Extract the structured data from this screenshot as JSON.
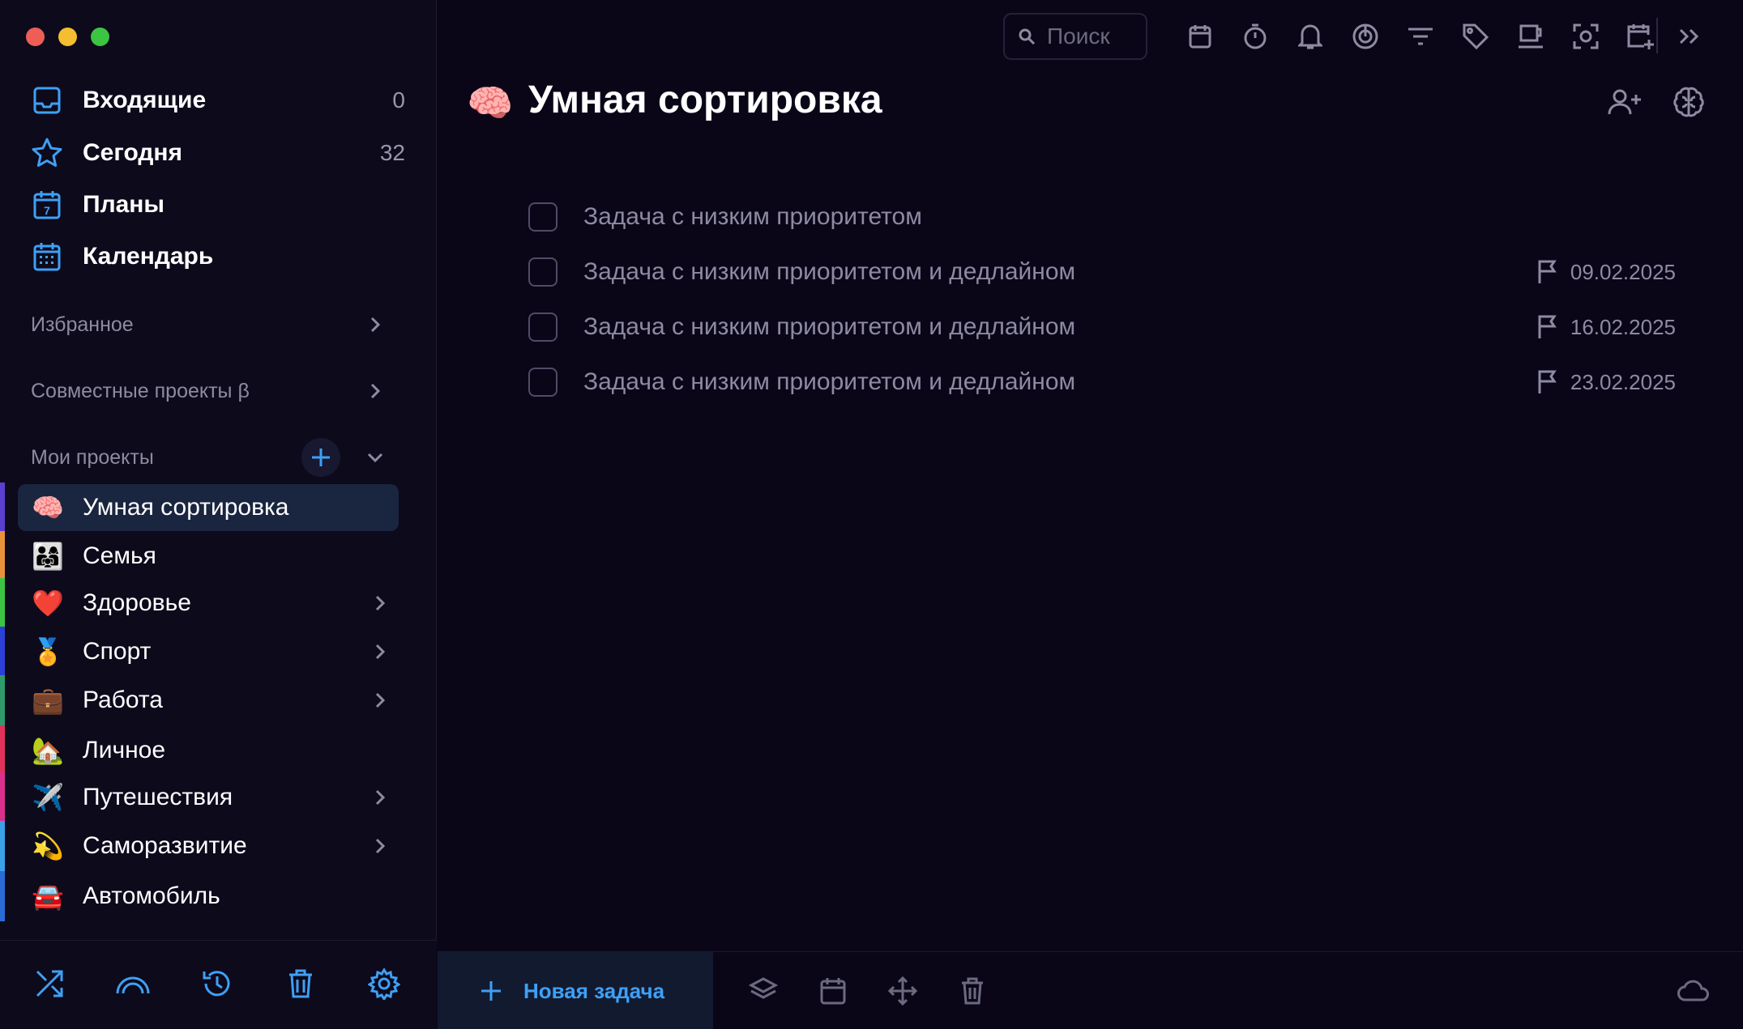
{
  "window": {
    "controls": [
      "close",
      "minimize",
      "zoom"
    ]
  },
  "colors": {
    "accent": "#3ea0f5",
    "background": "#0a0618",
    "sidebar": "#0d0a1c",
    "active_item": "#1a2540",
    "muted_text": "#8d8aa2"
  },
  "sidebar": {
    "nav": [
      {
        "label": "Входящие",
        "count": "0",
        "icon": "inbox-icon"
      },
      {
        "label": "Сегодня",
        "count": "32",
        "icon": "star-icon"
      },
      {
        "label": "Планы",
        "count": "",
        "icon": "calendar-7-icon"
      },
      {
        "label": "Календарь",
        "count": "",
        "icon": "calendar-grid-icon"
      }
    ],
    "sections": {
      "favorites": "Избранное",
      "shared": "Совместные проекты β",
      "my_projects": "Мои проекты"
    },
    "projects": [
      {
        "emoji": "🧠",
        "label": "Умная сортировка",
        "active": true,
        "expandable": false,
        "stripe": "#5b3fd0"
      },
      {
        "emoji": "👨‍👩‍👧",
        "label": "Семья",
        "active": false,
        "expandable": false,
        "stripe": "#e8923a"
      },
      {
        "emoji": "❤️",
        "label": "Здоровье",
        "active": false,
        "expandable": true,
        "stripe": "#3cc443"
      },
      {
        "emoji": "🏅",
        "label": "Спорт",
        "active": false,
        "expandable": true,
        "stripe": "#2c3fd8"
      },
      {
        "emoji": "💼",
        "label": "Работа",
        "active": false,
        "expandable": true,
        "stripe": "#2f9a6a"
      },
      {
        "emoji": "🏡",
        "label": "Личное",
        "active": false,
        "expandable": false,
        "stripe": "#e0325a"
      },
      {
        "emoji": "✈️",
        "label": "Путешествия",
        "active": false,
        "expandable": true,
        "stripe": "#d9308e"
      },
      {
        "emoji": "💫",
        "label": "Саморазвитие",
        "active": false,
        "expandable": true,
        "stripe": "#3aa0e8"
      },
      {
        "emoji": "🚘",
        "label": "Автомобиль",
        "active": false,
        "expandable": false,
        "stripe": "#2b6bd6"
      }
    ],
    "bottom_icons": [
      "shuffle-icon",
      "rainbow-icon",
      "history-icon",
      "trash-icon",
      "settings-icon"
    ]
  },
  "toolbar": {
    "search_placeholder": "Поиск",
    "icons": [
      "calendar-icon",
      "timer-icon",
      "bell-icon",
      "focus-icon",
      "filter-icon",
      "tag-icon",
      "coffee-icon",
      "capture-icon",
      "add-calendar-icon",
      "expand-icon"
    ]
  },
  "header": {
    "emoji": "🧠",
    "title": "Умная сортировка",
    "icons": [
      "add-member-icon",
      "brain-icon"
    ]
  },
  "tasks": [
    {
      "label": "Задача с низким приоритетом",
      "date": ""
    },
    {
      "label": "Задача с низким приоритетом и дедлайном",
      "date": "09.02.2025"
    },
    {
      "label": "Задача с низким приоритетом и дедлайном",
      "date": "16.02.2025"
    },
    {
      "label": "Задача с низким приоритетом и дедлайном",
      "date": "23.02.2025"
    }
  ],
  "bottom_bar": {
    "new_task": "Новая задача",
    "icons": [
      "layers-icon",
      "calendar-icon",
      "move-icon",
      "trash-icon",
      "cloud-icon"
    ]
  }
}
